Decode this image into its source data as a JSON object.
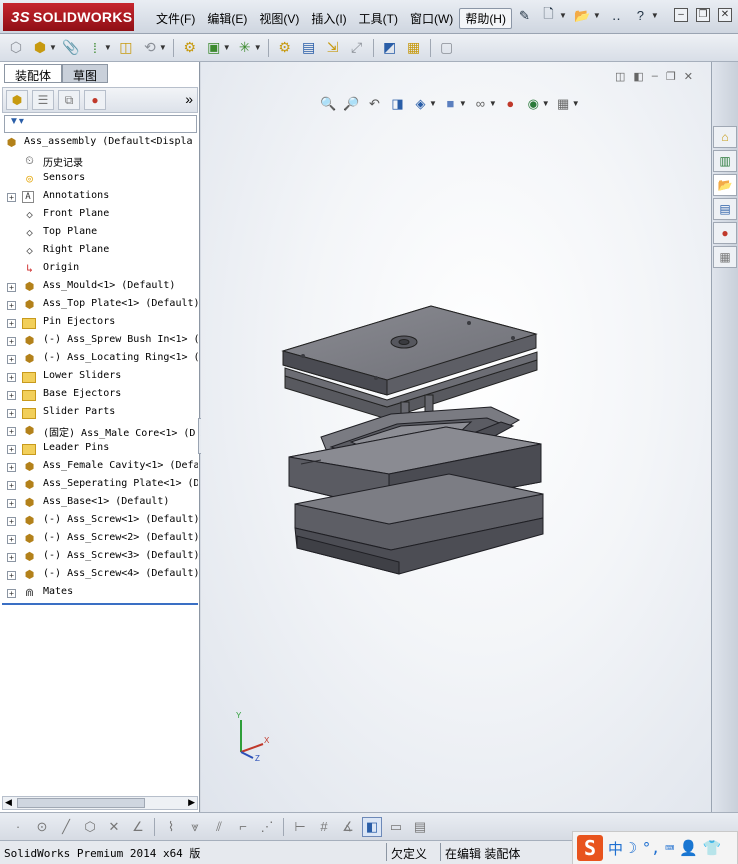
{
  "titlebar": {
    "brand": "SOLIDWORKS",
    "brand_mark": "3S",
    "menus": [
      "文件(F)",
      "编辑(E)",
      "视图(V)",
      "插入(I)",
      "工具(T)",
      "窗口(W)",
      "帮助(H)"
    ],
    "active_menu_index": 6
  },
  "panel": {
    "tabs": [
      "装配体",
      "草图"
    ],
    "tree": [
      {
        "label": "Ass_assembly  (Default<Displa",
        "icon": "assembly-icon",
        "root": true
      },
      {
        "label": "历史记录",
        "icon": "history-icon"
      },
      {
        "label": "Sensors",
        "icon": "sensor-icon"
      },
      {
        "label": "Annotations",
        "icon": "annotations-icon",
        "expand": "+"
      },
      {
        "label": "Front Plane",
        "icon": "plane-icon"
      },
      {
        "label": "Top Plane",
        "icon": "plane-icon"
      },
      {
        "label": "Right Plane",
        "icon": "plane-icon"
      },
      {
        "label": "Origin",
        "icon": "origin-icon"
      },
      {
        "label": "Ass_Mould<1> (Default)",
        "icon": "subassembly-icon",
        "expand": "+"
      },
      {
        "label": "Ass_Top Plate<1> (Default)",
        "icon": "subassembly-icon",
        "expand": "+"
      },
      {
        "label": "Pin Ejectors",
        "icon": "folder-icon",
        "expand": "+"
      },
      {
        "label": "(-) Ass_Sprew Bush In<1> (",
        "icon": "subassembly-icon",
        "expand": "+"
      },
      {
        "label": "(-) Ass_Locating Ring<1> (",
        "icon": "subassembly-icon",
        "expand": "+"
      },
      {
        "label": "Lower Sliders",
        "icon": "folder-icon",
        "expand": "+"
      },
      {
        "label": "Base Ejectors",
        "icon": "folder-icon",
        "expand": "+"
      },
      {
        "label": "Slider Parts",
        "icon": "folder-icon",
        "expand": "+"
      },
      {
        "label": "(固定) Ass_Male Core<1> (D",
        "icon": "subassembly-icon",
        "expand": "+"
      },
      {
        "label": "Leader Pins",
        "icon": "folder-icon",
        "expand": "+"
      },
      {
        "label": "Ass_Female Cavity<1> (Defa",
        "icon": "subassembly-icon",
        "expand": "+"
      },
      {
        "label": "Ass_Seperating Plate<1> (D",
        "icon": "subassembly-icon",
        "expand": "+"
      },
      {
        "label": "Ass_Base<1> (Default)",
        "icon": "subassembly-icon",
        "expand": "+"
      },
      {
        "label": "(-) Ass_Screw<1> (Default)",
        "icon": "subassembly-icon",
        "expand": "+"
      },
      {
        "label": "(-) Ass_Screw<2> (Default)",
        "icon": "subassembly-icon",
        "expand": "+"
      },
      {
        "label": "(-) Ass_Screw<3> (Default)",
        "icon": "subassembly-icon",
        "expand": "+"
      },
      {
        "label": "(-) Ass_Screw<4> (Default)",
        "icon": "subassembly-icon",
        "expand": "+"
      },
      {
        "label": "Mates",
        "icon": "mates-icon",
        "expand": "+"
      }
    ]
  },
  "triad": {
    "x": "X",
    "y": "Y",
    "z": "Z"
  },
  "status": {
    "app": "SolidWorks Premium 2014 x64 版",
    "underdefined": "欠定义",
    "editing": "在编辑 装配体"
  },
  "ime": {
    "logo": "S",
    "lang": "中"
  },
  "colors": {
    "brand": "#b31b22",
    "model_gray": "#6f7077",
    "selection_blue": "#3a6fc4"
  }
}
